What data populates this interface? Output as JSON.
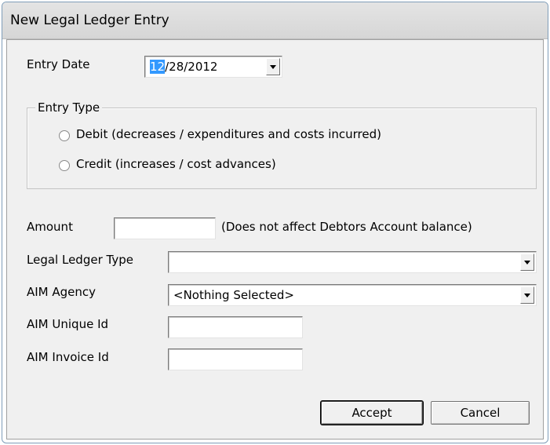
{
  "window": {
    "title": "New Legal Ledger Entry"
  },
  "entry_date": {
    "label": "Entry Date",
    "month_selected": "12",
    "rest": "/28/2012"
  },
  "entry_type": {
    "legend": "Entry Type",
    "options": [
      {
        "label": "Debit (decreases / expenditures and costs incurred)",
        "selected": false
      },
      {
        "label": "Credit (increases / cost advances)",
        "selected": false
      }
    ]
  },
  "amount": {
    "label": "Amount",
    "value": "",
    "note": "(Does not affect Debtors Account balance)"
  },
  "legal_ledger_type": {
    "label": "Legal Ledger Type",
    "value": ""
  },
  "aim_agency": {
    "label": "AIM Agency",
    "value": "<Nothing Selected>"
  },
  "aim_unique_id": {
    "label": "AIM Unique Id",
    "value": ""
  },
  "aim_invoice_id": {
    "label": "AIM Invoice Id",
    "value": ""
  },
  "buttons": {
    "accept": "Accept",
    "cancel": "Cancel"
  }
}
